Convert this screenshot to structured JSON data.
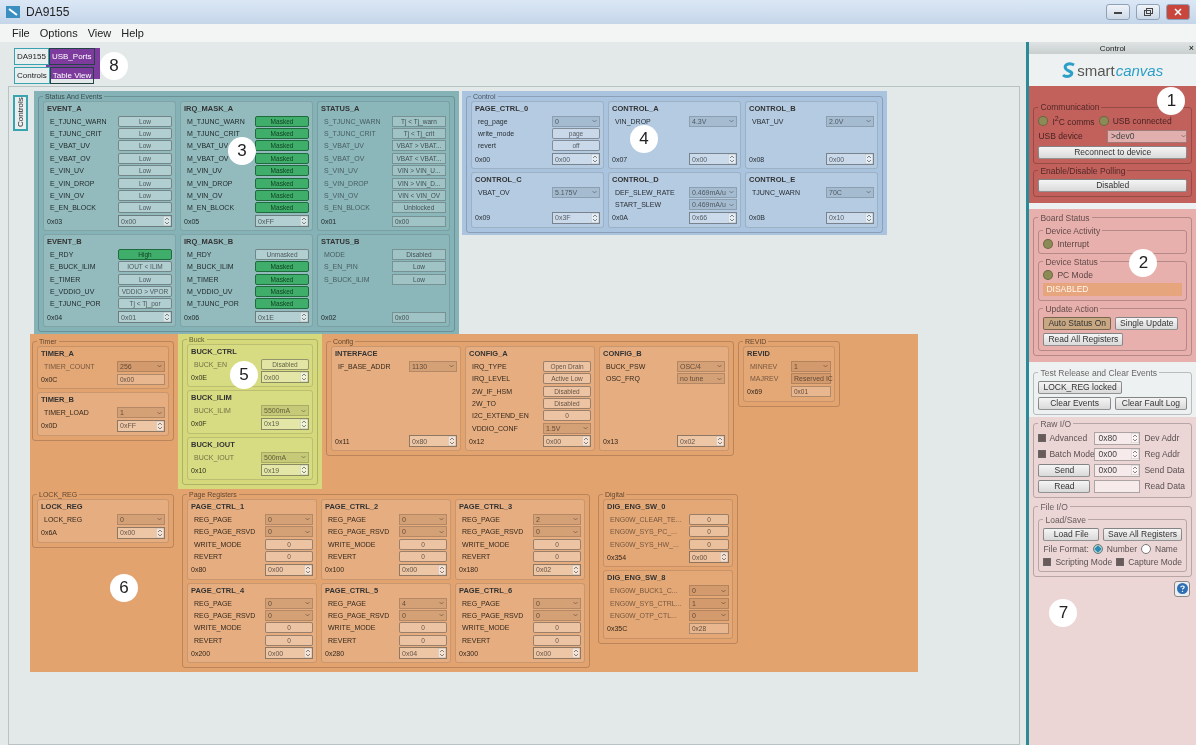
{
  "window": {
    "title": "DA9155"
  },
  "menu": [
    "File",
    "Options",
    "View",
    "Help"
  ],
  "tabs": {
    "annotation": {
      "number": "8",
      "color": "#7d3b9d"
    },
    "top": [
      {
        "label": "DA9155",
        "selected": true
      },
      {
        "label": "USB_Ports",
        "selected": false
      }
    ],
    "sub": [
      {
        "label": "Controls",
        "selected": true
      },
      {
        "label": "Table View",
        "selected": false
      }
    ],
    "side": [
      {
        "label": "Controls",
        "selected": true
      }
    ]
  },
  "status_events": {
    "title": "Status And Events",
    "annotation": {
      "number": "3",
      "color": "#84b2b6"
    },
    "registers": [
      {
        "name": "EVENT_A",
        "dimmed": false,
        "address": "0x03",
        "readout": {
          "kind": "spin",
          "value": "0x00"
        },
        "rows": [
          {
            "label": "E_TJUNC_WARN",
            "kind": "button",
            "value": "Low",
            "on": false
          },
          {
            "label": "E_TJUNC_CRIT",
            "kind": "button",
            "value": "Low",
            "on": false
          },
          {
            "label": "E_VBAT_UV",
            "kind": "button",
            "value": "Low",
            "on": false
          },
          {
            "label": "E_VBAT_OV",
            "kind": "button",
            "value": "Low",
            "on": false
          },
          {
            "label": "E_VIN_UV",
            "kind": "button",
            "value": "Low",
            "on": false
          },
          {
            "label": "E_VIN_DROP",
            "kind": "button",
            "value": "Low",
            "on": false
          },
          {
            "label": "E_VIN_OV",
            "kind": "button",
            "value": "Low",
            "on": false
          },
          {
            "label": "E_EN_BLOCK",
            "kind": "button",
            "value": "Low",
            "on": false
          }
        ]
      },
      {
        "name": "IRQ_MASK_A",
        "dimmed": false,
        "address": "0x05",
        "readout": {
          "kind": "spin",
          "value": "0xFF"
        },
        "rows": [
          {
            "label": "M_TJUNC_WARN",
            "kind": "button",
            "value": "Masked",
            "on": true
          },
          {
            "label": "M_TJUNC_CRIT",
            "kind": "button",
            "value": "Masked",
            "on": true
          },
          {
            "label": "M_VBAT_UV",
            "kind": "button",
            "value": "Masked",
            "on": true
          },
          {
            "label": "M_VBAT_OV",
            "kind": "button",
            "value": "Masked",
            "on": true
          },
          {
            "label": "M_VIN_UV",
            "kind": "button",
            "value": "Masked",
            "on": true
          },
          {
            "label": "M_VIN_DROP",
            "kind": "button",
            "value": "Masked",
            "on": true
          },
          {
            "label": "M_VIN_OV",
            "kind": "button",
            "value": "Masked",
            "on": true
          },
          {
            "label": "M_EN_BLOCK",
            "kind": "button",
            "value": "Masked",
            "on": true
          }
        ]
      },
      {
        "name": "STATUS_A",
        "dimmed": true,
        "address": "0x01",
        "readout": {
          "kind": "field",
          "value": "0x00"
        },
        "rows": [
          {
            "label": "S_TJUNC_WARN",
            "kind": "field",
            "value": "Tj < Tj_warn"
          },
          {
            "label": "S_TJUNC_CRIT",
            "kind": "field",
            "value": "Tj < Tj_crit"
          },
          {
            "label": "S_VBAT_UV",
            "kind": "field",
            "value": "VBAT > VBAT..."
          },
          {
            "label": "S_VBAT_OV",
            "kind": "field",
            "value": "VBAT < VBAT..."
          },
          {
            "label": "S_VIN_UV",
            "kind": "field",
            "value": "VIN > VIN_U..."
          },
          {
            "label": "S_VIN_DROP",
            "kind": "field",
            "value": "VIN > VIN_D..."
          },
          {
            "label": "S_VIN_OV",
            "kind": "field",
            "value": "VIN < VIN_OV"
          },
          {
            "label": "S_EN_BLOCK",
            "kind": "field",
            "value": "Unblocked"
          }
        ]
      },
      {
        "name": "EVENT_B",
        "dimmed": false,
        "address": "0x04",
        "readout": {
          "kind": "spin",
          "value": "0x01"
        },
        "rows": [
          {
            "label": "E_RDY",
            "kind": "button",
            "value": "High",
            "on": true
          },
          {
            "label": "E_BUCK_ILIM",
            "kind": "button",
            "value": "IOUT < ILIM",
            "on": false
          },
          {
            "label": "E_TIMER",
            "kind": "button",
            "value": "Low",
            "on": false
          },
          {
            "label": "E_VDDIO_UV",
            "kind": "button",
            "value": "VDDIO > VPOR",
            "on": false
          },
          {
            "label": "E_TJUNC_POR",
            "kind": "button",
            "value": "Tj < Tj_por",
            "on": false
          }
        ]
      },
      {
        "name": "IRQ_MASK_B",
        "dimmed": false,
        "address": "0x06",
        "readout": {
          "kind": "spin",
          "value": "0x1E"
        },
        "rows": [
          {
            "label": "M_RDY",
            "kind": "button",
            "value": "Unmasked",
            "on": false
          },
          {
            "label": "M_BUCK_ILIM",
            "kind": "button",
            "value": "Masked",
            "on": true
          },
          {
            "label": "M_TIMER",
            "kind": "button",
            "value": "Masked",
            "on": true
          },
          {
            "label": "M_VDDIO_UV",
            "kind": "button",
            "value": "Masked",
            "on": true
          },
          {
            "label": "M_TJUNC_POR",
            "kind": "button",
            "value": "Masked",
            "on": true
          }
        ]
      },
      {
        "name": "STATUS_B",
        "dimmed": true,
        "address": "0x02",
        "readout": {
          "kind": "field",
          "value": "0x00"
        },
        "rows": [
          {
            "label": "MODE",
            "kind": "field",
            "value": "Disabled"
          },
          {
            "label": "S_EN_PIN",
            "kind": "field",
            "value": "Low"
          },
          {
            "label": "S_BUCK_ILIM",
            "kind": "field",
            "value": "Low"
          }
        ]
      }
    ]
  },
  "control": {
    "title": "Control",
    "annotation": {
      "number": "4",
      "color": "#aac4df"
    },
    "registers": [
      {
        "name": "PAGE_CTRL_0",
        "dimmed": false,
        "address": "0x00",
        "readout": {
          "kind": "spin",
          "value": "0x00"
        },
        "rows": [
          {
            "label": "reg_page",
            "kind": "select",
            "value": "0"
          },
          {
            "label": "write_mode",
            "kind": "button",
            "value": "page"
          },
          {
            "label": "revert",
            "kind": "button",
            "value": "off"
          }
        ]
      },
      {
        "name": "CONTROL_A",
        "dimmed": false,
        "address": "0x07",
        "readout": {
          "kind": "spin",
          "value": "0x00"
        },
        "rows": [
          {
            "label": "VIN_DROP",
            "kind": "select",
            "value": "4.3V"
          }
        ]
      },
      {
        "name": "CONTROL_B",
        "dimmed": false,
        "address": "0x08",
        "readout": {
          "kind": "spin",
          "value": "0x00"
        },
        "rows": [
          {
            "label": "VBAT_UV",
            "kind": "select",
            "value": "2.0V"
          }
        ]
      },
      {
        "name": "CONTROL_C",
        "dimmed": false,
        "address": "0x09",
        "readout": {
          "kind": "spin",
          "value": "0x3F"
        },
        "rows": [
          {
            "label": "VBAT_OV",
            "kind": "select",
            "value": "5.175V"
          }
        ]
      },
      {
        "name": "CONTROL_D",
        "dimmed": false,
        "address": "0x0A",
        "readout": {
          "kind": "spin",
          "value": "0x66"
        },
        "rows": [
          {
            "label": "DEF_SLEW_RATE",
            "kind": "select",
            "value": "0.469mA/u"
          },
          {
            "label": "START_SLEW",
            "kind": "select",
            "value": "0.469mA/u"
          }
        ]
      },
      {
        "name": "CONTROL_E",
        "dimmed": false,
        "address": "0x0B",
        "readout": {
          "kind": "spin",
          "value": "0x10"
        },
        "rows": [
          {
            "label": "TJUNC_WARN",
            "kind": "select",
            "value": "70C"
          }
        ]
      }
    ]
  },
  "settings_area": {
    "annotation": {
      "number": "6",
      "color": "#e3a36f"
    },
    "timer": {
      "title": "Timer",
      "registers": [
        {
          "name": "TIMER_A",
          "dimmed": true,
          "address": "0x0C",
          "readout": {
            "kind": "field",
            "value": "0x00"
          },
          "rows": [
            {
              "label": "TIMER_COUNT",
              "kind": "select",
              "value": "256"
            }
          ]
        },
        {
          "name": "TIMER_B",
          "dimmed": false,
          "address": "0x0D",
          "readout": {
            "kind": "spin",
            "value": "0xFF"
          },
          "rows": [
            {
              "label": "TIMER_LOAD",
              "kind": "select",
              "value": "1"
            }
          ]
        }
      ]
    },
    "buck": {
      "title": "Buck",
      "annotation": {
        "number": "5",
        "color": "#d5d97b"
      },
      "registers": [
        {
          "name": "BUCK_CTRL",
          "dimmed": true,
          "address": "0x0E",
          "readout": {
            "kind": "spin",
            "value": "0x00"
          },
          "rows": [
            {
              "label": "BUCK_EN",
              "kind": "button",
              "value": "Disabled"
            }
          ]
        },
        {
          "name": "BUCK_ILIM",
          "dimmed": true,
          "address": "0x0F",
          "readout": {
            "kind": "spin",
            "value": "0x19"
          },
          "rows": [
            {
              "label": "BUCK_ILIM",
              "kind": "select",
              "value": "5500mA"
            }
          ]
        },
        {
          "name": "BUCK_IOUT",
          "dimmed": true,
          "address": "0x10",
          "readout": {
            "kind": "spin",
            "value": "0x19"
          },
          "rows": [
            {
              "label": "BUCK_IOUT",
              "kind": "select",
              "value": "500mA"
            }
          ]
        }
      ]
    },
    "config": {
      "title": "Config",
      "registers": [
        {
          "name": "INTERFACE",
          "dimmed": false,
          "address": "0x11",
          "readout": {
            "kind": "spin",
            "value": "0x80"
          },
          "rows": [
            {
              "label": "IF_BASE_ADDR",
              "kind": "select",
              "value": "1130"
            }
          ]
        },
        {
          "name": "CONFIG_A",
          "dimmed": false,
          "address": "0x12",
          "readout": {
            "kind": "spin",
            "value": "0x00"
          },
          "rows": [
            {
              "label": "IRQ_TYPE",
              "kind": "button",
              "value": "Open Drain"
            },
            {
              "label": "IRQ_LEVEL",
              "kind": "button",
              "value": "Active Low"
            },
            {
              "label": "2W_IF_HSM",
              "kind": "button",
              "value": "Disabled"
            },
            {
              "label": "2W_TO",
              "kind": "button",
              "value": "Disabled"
            },
            {
              "label": "I2C_EXTEND_EN",
              "kind": "button",
              "value": "0"
            },
            {
              "label": "VDDIO_CONF",
              "kind": "select",
              "value": "1.5V"
            }
          ]
        },
        {
          "name": "CONFIG_B",
          "dimmed": false,
          "address": "0x13",
          "readout": {
            "kind": "spin",
            "value": "0x02"
          },
          "rows": [
            {
              "label": "BUCK_PSW",
              "kind": "select",
              "value": "OSC/4"
            },
            {
              "label": "OSC_FRQ",
              "kind": "select",
              "value": "no tune"
            }
          ]
        }
      ]
    },
    "revid": {
      "title": "REVID",
      "registers": [
        {
          "name": "REVID",
          "dimmed": true,
          "address": "0x69",
          "readout": {
            "kind": "field",
            "value": "0x01"
          },
          "rows": [
            {
              "label": "MINREV",
              "kind": "select",
              "value": "1"
            },
            {
              "label": "MAJREV",
              "kind": "select",
              "value": "Reserved IC"
            }
          ]
        }
      ]
    },
    "lock_reg": {
      "title": "LOCK_REG",
      "registers": [
        {
          "name": "LOCK_REG",
          "dimmed": false,
          "address": "0x6A",
          "readout": {
            "kind": "spin",
            "value": "0x00"
          },
          "rows": [
            {
              "label": "LOCK_REG",
              "kind": "select",
              "value": "0"
            }
          ]
        }
      ]
    },
    "page_registers": {
      "title": "Page Registers",
      "registers": [
        {
          "name": "PAGE_CTRL_1",
          "dimmed": false,
          "address": "0x80",
          "readout": {
            "kind": "spin",
            "value": "0x00"
          },
          "rows": [
            {
              "label": "REG_PAGE",
              "kind": "select",
              "value": "0"
            },
            {
              "label": "REG_PAGE_RSVD",
              "kind": "select",
              "value": "0"
            },
            {
              "label": "WRITE_MODE",
              "kind": "button",
              "value": "0"
            },
            {
              "label": "REVERT",
              "kind": "button",
              "value": "0"
            }
          ]
        },
        {
          "name": "PAGE_CTRL_2",
          "dimmed": false,
          "address": "0x100",
          "readout": {
            "kind": "spin",
            "value": "0x00"
          },
          "rows": [
            {
              "label": "REG_PAGE",
              "kind": "select",
              "value": "0"
            },
            {
              "label": "REG_PAGE_RSVD",
              "kind": "select",
              "value": "0"
            },
            {
              "label": "WRITE_MODE",
              "kind": "button",
              "value": "0"
            },
            {
              "label": "REVERT",
              "kind": "button",
              "value": "0"
            }
          ]
        },
        {
          "name": "PAGE_CTRL_3",
          "dimmed": false,
          "address": "0x180",
          "readout": {
            "kind": "spin",
            "value": "0x02"
          },
          "rows": [
            {
              "label": "REG_PAGE",
              "kind": "select",
              "value": "2"
            },
            {
              "label": "REG_PAGE_RSVD",
              "kind": "select",
              "value": "0"
            },
            {
              "label": "WRITE_MODE",
              "kind": "button",
              "value": "0"
            },
            {
              "label": "REVERT",
              "kind": "button",
              "value": "0"
            }
          ]
        },
        {
          "name": "PAGE_CTRL_4",
          "dimmed": false,
          "address": "0x200",
          "readout": {
            "kind": "spin",
            "value": "0x00"
          },
          "rows": [
            {
              "label": "REG_PAGE",
              "kind": "select",
              "value": "0"
            },
            {
              "label": "REG_PAGE_RSVD",
              "kind": "select",
              "value": "0"
            },
            {
              "label": "WRITE_MODE",
              "kind": "button",
              "value": "0"
            },
            {
              "label": "REVERT",
              "kind": "button",
              "value": "0"
            }
          ]
        },
        {
          "name": "PAGE_CTRL_5",
          "dimmed": false,
          "address": "0x280",
          "readout": {
            "kind": "spin",
            "value": "0x04"
          },
          "rows": [
            {
              "label": "REG_PAGE",
              "kind": "select",
              "value": "4"
            },
            {
              "label": "REG_PAGE_RSVD",
              "kind": "select",
              "value": "0"
            },
            {
              "label": "WRITE_MODE",
              "kind": "button",
              "value": "0"
            },
            {
              "label": "REVERT",
              "kind": "button",
              "value": "0"
            }
          ]
        },
        {
          "name": "PAGE_CTRL_6",
          "dimmed": false,
          "address": "0x300",
          "readout": {
            "kind": "spin",
            "value": "0x00"
          },
          "rows": [
            {
              "label": "REG_PAGE",
              "kind": "select",
              "value": "0"
            },
            {
              "label": "REG_PAGE_RSVD",
              "kind": "select",
              "value": "0"
            },
            {
              "label": "WRITE_MODE",
              "kind": "button",
              "value": "0"
            },
            {
              "label": "REVERT",
              "kind": "button",
              "value": "0"
            }
          ]
        }
      ]
    },
    "digital": {
      "title": "Digital",
      "registers": [
        {
          "name": "DIG_ENG_SW_0",
          "dimmed": true,
          "address": "0x354",
          "readout": {
            "kind": "spin",
            "value": "0x00"
          },
          "rows": [
            {
              "label": "ENG0W_CLEAR_TE...",
              "kind": "button",
              "value": "0"
            },
            {
              "label": "ENG0W_SYS_PC_...",
              "kind": "button",
              "value": "0"
            },
            {
              "label": "ENG0W_SYS_HW_...",
              "kind": "button",
              "value": "0"
            }
          ]
        },
        {
          "name": "DIG_ENG_SW_8",
          "dimmed": true,
          "address": "0x35C",
          "readout": {
            "kind": "field",
            "value": "0x28"
          },
          "rows": [
            {
              "label": "ENG0W_BUCK1_C...",
              "kind": "select",
              "value": "0"
            },
            {
              "label": "ENG0W_SYS_CTRL...",
              "kind": "select",
              "value": "1"
            },
            {
              "label": "ENG0W_OTP_CTL...",
              "kind": "select",
              "value": "0"
            }
          ]
        }
      ]
    }
  },
  "side_panel": {
    "title": "Control",
    "close": "×",
    "logo": [
      "smart",
      "canvas"
    ],
    "connection": {
      "annotation": {
        "number": "1",
        "color": "#c2605c"
      },
      "communication": {
        "title": "Communication",
        "leds": [
          {
            "label": "I$^{2}$C comms",
            "on": false
          },
          {
            "label": "USB connected",
            "on": false
          }
        ],
        "usb_device_label": "USB device",
        "usb_device_value": ">dev0",
        "reconnect": "Reconnect to device"
      },
      "polling": {
        "title": "Enable/Disable Polling",
        "button": "Disabled"
      }
    },
    "board_status": {
      "title": "Board Status",
      "annotation": {
        "number": "2",
        "color": "#e8b0ad"
      },
      "device_activity": {
        "title": "Device Activity",
        "leds": [
          {
            "label": "Interrupt",
            "on": false
          }
        ]
      },
      "device_status": {
        "title": "Device Status",
        "leds": [
          {
            "label": "PC Mode",
            "on": false
          }
        ],
        "mode": "DISABLED"
      },
      "update_action": {
        "title": "Update Action",
        "buttons": [
          {
            "label": "Auto Status On",
            "selected": true
          },
          {
            "label": "Single Update",
            "selected": false
          },
          {
            "label": "Read All Registers",
            "selected": false
          }
        ]
      }
    },
    "test_release": {
      "title": "Test Release and Clear Events",
      "buttons": [
        "LOCK_REG locked",
        "Clear Events",
        "Clear Fault Log"
      ]
    },
    "io": {
      "annotation": {
        "number": "7",
        "color": "#ecd5d5"
      },
      "raw_io": {
        "title": "Raw I/O",
        "rows": [
          {
            "kind": "check",
            "label": "Advanced",
            "checked": true,
            "value": "0x80",
            "caption": "Dev Addr"
          },
          {
            "kind": "check",
            "label": "Batch Mode",
            "checked": true,
            "value": "0x00",
            "caption": "Reg Addr"
          },
          {
            "kind": "button",
            "label": "Send",
            "value": "0x00",
            "caption": "Send Data"
          },
          {
            "kind": "button",
            "label": "Read",
            "caption": "Read Data"
          }
        ]
      },
      "file_io": {
        "title": "File I/O",
        "load_save": "Load/Save",
        "buttons": [
          "Load File",
          "Save All Registers"
        ],
        "format_label": "File Format:",
        "formats": [
          {
            "label": "Number",
            "selected": true
          },
          {
            "label": "Name",
            "selected": false
          }
        ],
        "modes": [
          {
            "label": "Scripting Mode",
            "checked": true
          },
          {
            "label": "Capture Mode",
            "checked": true
          }
        ]
      }
    }
  }
}
